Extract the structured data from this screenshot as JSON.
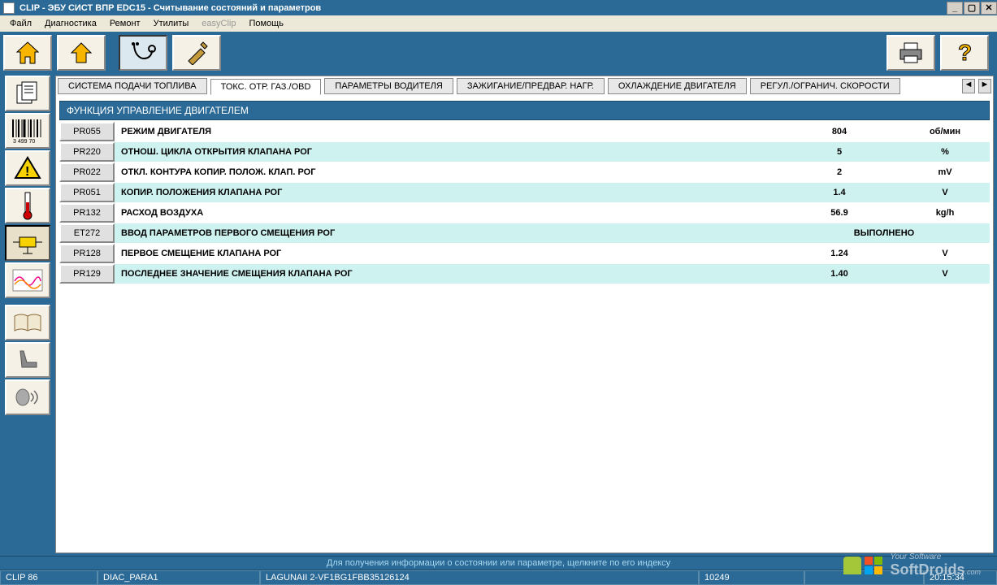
{
  "window": {
    "title": "CLIP - ЭБУ СИСТ ВПР EDC15 - Считывание состояний и параметров"
  },
  "menu": {
    "file": "Файл",
    "diagnostic": "Диагностика",
    "repair": "Ремонт",
    "utilities": "Утилиты",
    "easyclip": "easyClip",
    "help": "Помощь"
  },
  "tabs": {
    "t0": "СИСТЕМА ПОДАЧИ ТОПЛИВА",
    "t1": "ТОКС. ОТР. ГАЗ./OBD",
    "t2": "ПАРАМЕТРЫ ВОДИТЕЛЯ",
    "t3": "ЗАЖИГАНИЕ/ПРЕДВАР. НАГР.",
    "t4": "ОХЛАЖДЕНИЕ ДВИГАТЕЛЯ",
    "t5": "РЕГУЛ./ОГРАНИЧ. СКОРОСТИ"
  },
  "section_title": "ФУНКЦИЯ УПРАВЛЕНИЕ ДВИГАТЕЛЕМ",
  "params": [
    {
      "code": "PR055",
      "label": "РЕЖИМ ДВИГАТЕЛЯ",
      "value": "804",
      "unit": "об/мин"
    },
    {
      "code": "PR220",
      "label": "ОТНОШ. ЦИКЛА ОТКРЫТИЯ КЛАПАНА РОГ",
      "value": "5",
      "unit": "%"
    },
    {
      "code": "PR022",
      "label": "ОТКЛ. КОНТУРА КОПИР. ПОЛОЖ. КЛАП. РОГ",
      "value": "2",
      "unit": "mV"
    },
    {
      "code": "PR051",
      "label": "КОПИР. ПОЛОЖЕНИЯ КЛАПАНА РОГ",
      "value": "1.4",
      "unit": "V"
    },
    {
      "code": "PR132",
      "label": "РАСХОД ВОЗДУХА",
      "value": "56.9",
      "unit": "kg/h"
    },
    {
      "code": "ET272",
      "label": "ВВОД ПАРАМЕТРОВ ПЕРВОГО СМЕЩЕНИЯ РОГ",
      "value": "ВЫПОЛНЕНО",
      "unit": ""
    },
    {
      "code": "PR128",
      "label": "ПЕРВОЕ СМЕЩЕНИЕ КЛАПАНА РОГ",
      "value": "1.24",
      "unit": "V"
    },
    {
      "code": "PR129",
      "label": "ПОСЛЕДНЕЕ ЗНАЧЕНИЕ СМЕЩЕНИЯ КЛАПАНА РОГ",
      "value": "1.40",
      "unit": "V"
    }
  ],
  "hint": "Для получения информации о состоянии или параметре, щелкните по его индексу",
  "status": {
    "s0": "CLIP 86",
    "s1": "DIAC_PARA1",
    "s2": "LAGUNAII 2-VF1BG1FBB35126124",
    "s3": "10249",
    "s4": "",
    "s5": "20:15:34"
  },
  "watermark": {
    "line1": "Your Software",
    "line2": "SoftDroids",
    "suffix": ".com"
  },
  "barcode_text": "3 499 70"
}
